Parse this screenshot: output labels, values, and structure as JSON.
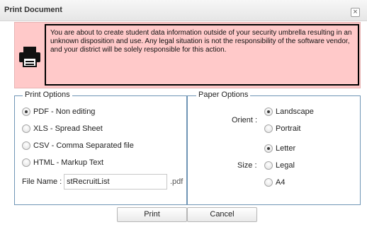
{
  "dialog": {
    "title": "Print Document",
    "close_glyph": "×"
  },
  "warning": {
    "icon": "printer-icon",
    "text": "You are about to create student data information outside of your security umbrella resulting in an unknown disposition and use. Any legal situation is not the responsibility of the software vendor, and your district will be solely responsible for this action."
  },
  "print_options": {
    "legend": "Print Options",
    "options": [
      {
        "label": "PDF - Non editing",
        "checked": true
      },
      {
        "label": "XLS - Spread Sheet",
        "checked": false
      },
      {
        "label": "CSV - Comma Separated file",
        "checked": false
      },
      {
        "label": "HTML - Markup Text",
        "checked": false
      }
    ],
    "file_name_label": "File Name :",
    "file_name_value": "stRecruitList",
    "file_ext": ".pdf"
  },
  "paper_options": {
    "legend": "Paper Options",
    "orient_label": "Orient :",
    "orient_options": [
      {
        "label": "Landscape",
        "checked": true
      },
      {
        "label": "Portrait",
        "checked": false
      }
    ],
    "size_label": "Size :",
    "size_options": [
      {
        "label": "Letter",
        "checked": true
      },
      {
        "label": "Legal",
        "checked": false
      },
      {
        "label": "A4",
        "checked": false
      }
    ]
  },
  "buttons": {
    "print": "Print",
    "cancel": "Cancel"
  }
}
